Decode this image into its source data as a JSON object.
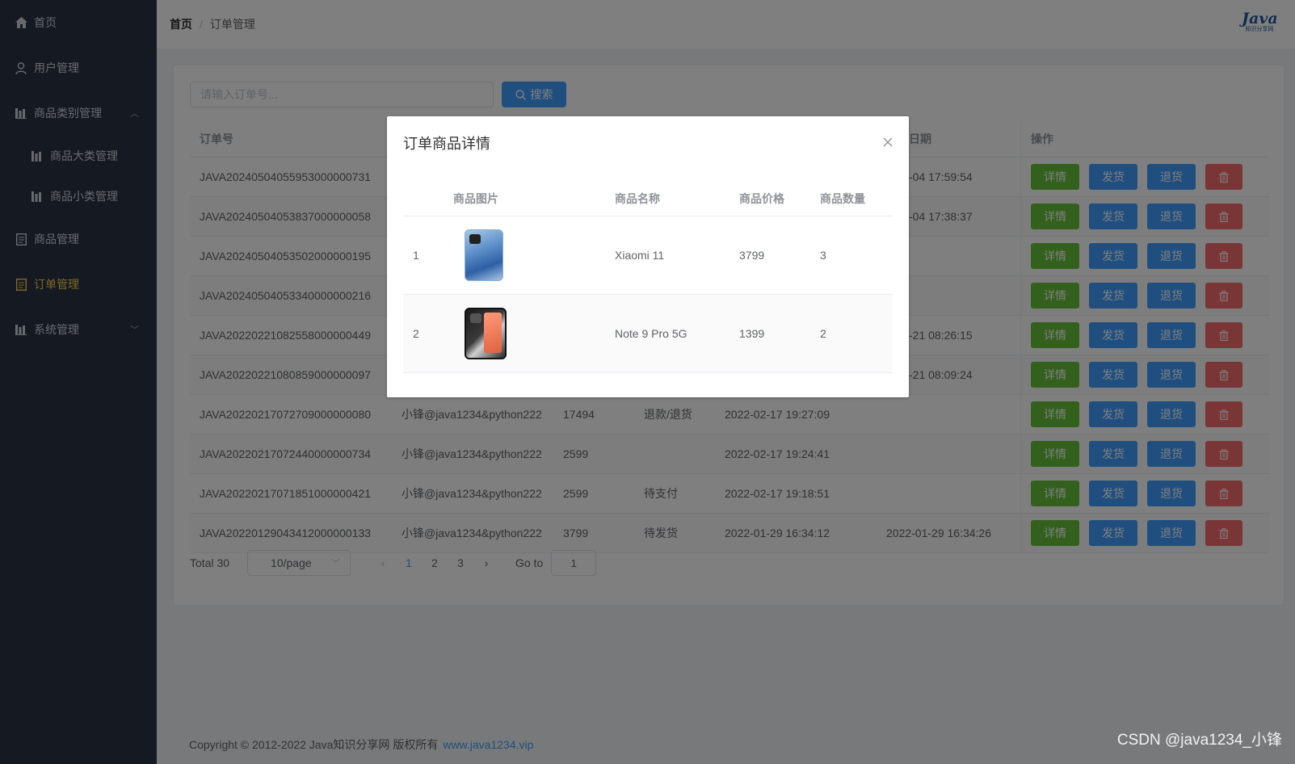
{
  "sidebar": {
    "items": [
      {
        "label": "首页",
        "icon": "home-icon"
      },
      {
        "label": "用户管理",
        "icon": "user-icon"
      },
      {
        "label": "商品类别管理",
        "icon": "chart-icon",
        "expanded": true
      },
      {
        "label": "商品大类管理",
        "icon": "chart-icon"
      },
      {
        "label": "商品小类管理",
        "icon": "chart-icon"
      },
      {
        "label": "商品管理",
        "icon": "document-icon"
      },
      {
        "label": "订单管理",
        "icon": "document-icon",
        "active": true
      },
      {
        "label": "系统管理",
        "icon": "chart-icon",
        "expanded": false
      }
    ],
    "active_color": "#ffd04b",
    "bg_color": "#2b3444"
  },
  "header": {
    "breadcrumb": [
      "首页",
      "订单管理"
    ],
    "logo_text": "Java",
    "logo_subtext": "知识分享网"
  },
  "search": {
    "placeholder": "请输入订单号...",
    "button_label": "搜索"
  },
  "table": {
    "headers": {
      "order_no": "订单号",
      "pay_date": "支付日期",
      "ops": "操作"
    },
    "buttons": {
      "detail": "详情",
      "ship": "发货",
      "return": "退货"
    },
    "rows": [
      {
        "order_no": "JAVA20240504055953000000731",
        "user": "",
        "amount": "",
        "status": "",
        "date": "",
        "pay_date": "4-05-04 17:59:54"
      },
      {
        "order_no": "JAVA20240504053837000000058",
        "user": "",
        "amount": "",
        "status": "",
        "date": "",
        "pay_date": "4-05-04 17:38:37"
      },
      {
        "order_no": "JAVA20240504053502000000195",
        "user": "",
        "amount": "",
        "status": "",
        "date": "",
        "pay_date": ""
      },
      {
        "order_no": "JAVA20240504053340000000216",
        "user": "",
        "amount": "",
        "status": "",
        "date": "",
        "pay_date": ""
      },
      {
        "order_no": "JAVA20220221082558000000449",
        "user": "",
        "amount": "",
        "status": "",
        "date": "",
        "pay_date": "2-02-21 08:26:15"
      },
      {
        "order_no": "JAVA20220221080859000000097",
        "user": "",
        "amount": "",
        "status": "",
        "date": "",
        "pay_date": "2-02-21 08:09:24"
      },
      {
        "order_no": "JAVA20220217072709000000080",
        "user": "小锋@java1234&python222",
        "amount": "17494",
        "status": "退款/退货",
        "date": "2022-02-17 19:27:09",
        "pay_date": ""
      },
      {
        "order_no": "JAVA20220217072440000000734",
        "user": "小锋@java1234&python222",
        "amount": "2599",
        "status": "",
        "date": "2022-02-17 19:24:41",
        "pay_date": ""
      },
      {
        "order_no": "JAVA20220217071851000000421",
        "user": "小锋@java1234&python222",
        "amount": "2599",
        "status": "待支付",
        "date": "2022-02-17 19:18:51",
        "pay_date": ""
      },
      {
        "order_no": "JAVA20220129043412000000133",
        "user": "小锋@java1234&python222",
        "amount": "3799",
        "status": "待发货",
        "date": "2022-01-29 16:34:12",
        "pay_date": "2022-01-29 16:34:26"
      }
    ]
  },
  "pagination": {
    "total": "Total 30",
    "page_size": "10/page",
    "pages": [
      "1",
      "2",
      "3"
    ],
    "current": "1",
    "goto_label": "Go to",
    "goto_value": "1"
  },
  "footer": {
    "text": "Copyright © 2012-2022 Java知识分享网 版权所有",
    "link": "www.java1234.vip"
  },
  "dialog": {
    "title": "订单商品详情",
    "headers": {
      "image": "商品图片",
      "name": "商品名称",
      "price": "商品价格",
      "qty": "商品数量"
    },
    "rows": [
      {
        "idx": "1",
        "name": "Xiaomi 11",
        "price": "3799",
        "qty": "3",
        "image_icon": "phone-blue-image"
      },
      {
        "idx": "2",
        "name": "Note 9 Pro 5G",
        "price": "1399",
        "qty": "2",
        "image_icon": "phone-dark-image"
      }
    ]
  },
  "watermark": "CSDN @java1234_小锋",
  "colors": {
    "primary": "#409eff",
    "success": "#67c23a",
    "danger": "#f56c6c"
  }
}
